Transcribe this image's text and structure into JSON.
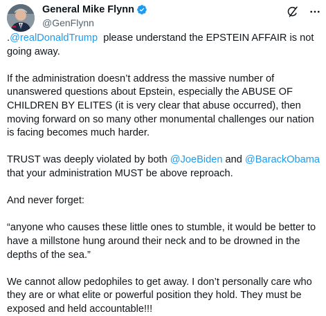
{
  "author": {
    "display_name": "General Mike Flynn",
    "handle": "@GenFlynn"
  },
  "colors": {
    "accent": "#1d9bf0",
    "text": "#0f1419",
    "secondary_text": "#536471"
  },
  "icons": {
    "verified": "verified-badge-icon",
    "grok": "grok-icon",
    "more": "more-icon"
  },
  "post": {
    "p1": {
      "lead": ".",
      "mention": "@realDonaldTrump",
      "text": "  please understand the EPSTEIN AFFAIR is not going away."
    },
    "p2": "If the administration doesn’t address the massive number of unanswered questions about Epstein, especially the ABUSE OF CHILDREN BY ELITES (it is very clear that abuse occurred), then moving forward on so many other monumental challenges our nation is facing becomes much harder.",
    "p3": {
      "before": "TRUST was deeply violated by both ",
      "mention1": "@JoeBiden",
      "middle": " and ",
      "mention2": "@BarackObama",
      "after": " that your administration MUST be above reproach."
    },
    "p4": "And never forget:",
    "p5": "“anyone who causes these little ones to stumble, it would be better to have a millstone hung around their neck and to be drowned in the depths of the sea.”",
    "p6": "We cannot allow pedophiles to get away. I don’t personally care who they are or what elite or powerful position they hold. They must be exposed and held accountable!!!"
  }
}
